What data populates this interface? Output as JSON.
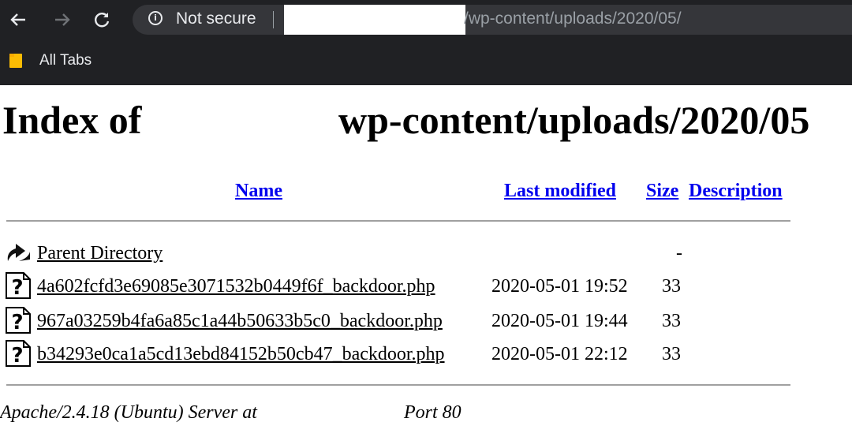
{
  "browser": {
    "url_security": "Not secure",
    "url_path": "/wp-content/uploads/2020/05/",
    "bookmarks": [
      {
        "label": "All Tabs",
        "icon": "folder-icon"
      }
    ]
  },
  "page": {
    "title_prefix": "Index of",
    "title_path": "wp-content/uploads/2020/05",
    "columns": {
      "name": "Name",
      "last_modified": "Last modified",
      "size": "Size",
      "description": "Description"
    },
    "parent": {
      "name": "Parent Directory",
      "size": "-"
    },
    "rows": [
      {
        "name": "4a602fcfd3e69085e3071532b0449f6f_backdoor.php",
        "last_modified": "2020-05-01 19:52",
        "size": "33",
        "description": ""
      },
      {
        "name": "967a03259b4fa6a85c1a44b50633b5c0_backdoor.php",
        "last_modified": "2020-05-01 19:44",
        "size": "33",
        "description": ""
      },
      {
        "name": "b34293e0ca1a5cd13ebd84152b50cb47_backdoor.php",
        "last_modified": "2020-05-01 22:12",
        "size": "33",
        "description": ""
      }
    ],
    "footer_server": "Apache/2.4.18 (Ubuntu) Server at",
    "footer_port": "Port 80"
  },
  "colors": {
    "chrome_bg": "#202124",
    "omnibox_bg": "#35363a",
    "link": "#0000ee",
    "folder": "#fbbc04"
  }
}
